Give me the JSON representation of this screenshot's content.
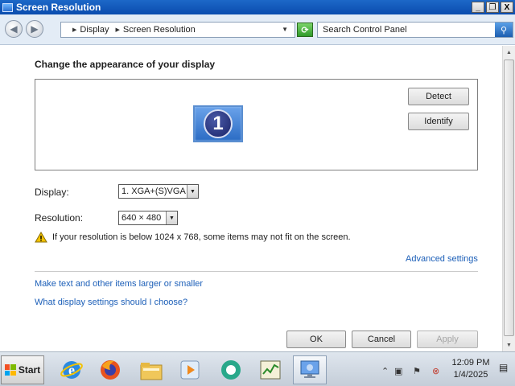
{
  "window": {
    "title": "Screen Resolution",
    "controls": {
      "minimize": "_",
      "restore": "❐",
      "close": "X"
    }
  },
  "address_bar": {
    "breadcrumbs": [
      "Display",
      "Screen Resolution"
    ],
    "search": {
      "placeholder": "Search Control Panel"
    }
  },
  "main": {
    "heading": "Change the appearance of your display",
    "monitor_number": "1",
    "detect_button": "Detect",
    "identify_button": "Identify",
    "display_label": "Display:",
    "display_value": "1. XGA+(S)VGA",
    "resolution_label": "Resolution:",
    "resolution_value": "640 × 480",
    "warning_text": "If your resolution is below 1024 x 768, some items may not fit on the screen.",
    "advanced_link": "Advanced settings",
    "link_text_size": "Make text and other items larger or smaller",
    "link_which_settings": "What display settings should I choose?",
    "ok_button": "OK",
    "cancel_button": "Cancel",
    "apply_button": "Apply"
  },
  "taskbar": {
    "start_label": "Start",
    "apps": [
      "internet-explorer",
      "firefox",
      "file-explorer",
      "media-player",
      "chat-app",
      "task-manager",
      "control-panel"
    ],
    "clock_time": "12:09 PM",
    "clock_date": "1/4/2025"
  },
  "colors": {
    "title_bar": "#0a4cae",
    "link": "#1c5fb8",
    "address_bar_bg": "#e3ecf6"
  }
}
